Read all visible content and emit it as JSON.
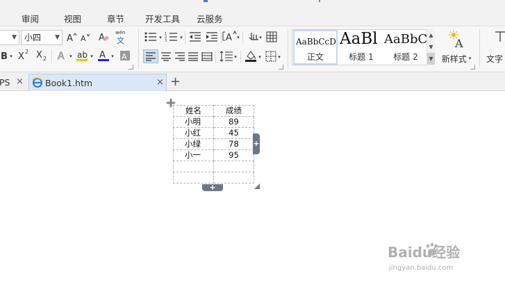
{
  "menu": {
    "tabs": [
      "审阅",
      "视图",
      "章节",
      "开发工具",
      "云服务"
    ]
  },
  "ribbon": {
    "font_size": "小四",
    "style_gallery": [
      {
        "sample": "AaBbCcDd",
        "name": "正文"
      },
      {
        "sample": "AaBl",
        "name": "标题 1"
      },
      {
        "sample": "AaBbC",
        "name": "标题 2"
      }
    ],
    "new_style_label": "新样式",
    "text_tool_label": "文字",
    "phonetic_top": "wén",
    "phonetic_bottom": "文"
  },
  "doc_tabs": {
    "partial_label": "PS",
    "active_label": "Book1.htm"
  },
  "table": {
    "headers": [
      "姓名",
      "成绩"
    ],
    "rows": [
      [
        "小明",
        "89"
      ],
      [
        "小红",
        "45"
      ],
      [
        "小绿",
        "78"
      ],
      [
        "小一",
        "95"
      ],
      [
        "",
        ""
      ],
      [
        "",
        ""
      ]
    ]
  },
  "watermark": {
    "brand": "Baidu经验",
    "url": "jingyan.baidu.com"
  },
  "colors": {
    "accent": "#4a7cc7",
    "font_color_underline": "#2222dd",
    "highlight_underline": "#f2c200",
    "table_handle": "#6d7885"
  }
}
